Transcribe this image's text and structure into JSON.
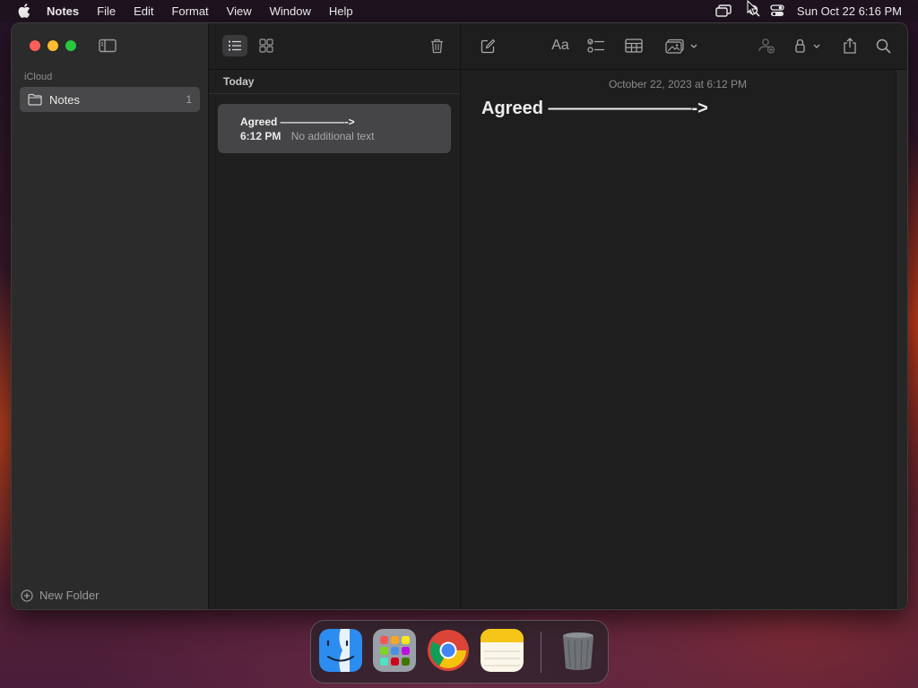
{
  "menubar": {
    "apple_icon": "apple-icon",
    "app_name": "Notes",
    "items": [
      "File",
      "Edit",
      "Format",
      "View",
      "Window",
      "Help"
    ],
    "clock": "Sun Oct 22  6:16 PM",
    "status_icons": [
      "screen-mirroring-icon",
      "spotlight-search-icon",
      "control-center-icon"
    ]
  },
  "sidebar": {
    "section_label": "iCloud",
    "folders": [
      {
        "label": "Notes",
        "count": "1",
        "icon": "folder-icon"
      }
    ],
    "new_folder_label": "New Folder"
  },
  "notelist": {
    "group_header": "Today",
    "notes": [
      {
        "title": "Agreed ——————->",
        "time": "6:12 PM",
        "preview": "No additional text"
      }
    ]
  },
  "editor": {
    "date": "October 22, 2023 at 6:12 PM",
    "title": "Agreed ————————->"
  },
  "toolbar_icons": {
    "list_view": "list-view-icon",
    "gallery_view": "gallery-view-icon",
    "delete": "trash-icon",
    "compose": "compose-icon",
    "format": "Aa",
    "checklist": "checklist-icon",
    "table": "table-icon",
    "media": "media-icon",
    "collaborate": "collaborate-icon",
    "lock": "lock-icon",
    "share": "share-icon",
    "search": "search-icon"
  },
  "dock": {
    "apps": [
      "Finder",
      "Launchpad",
      "Google Chrome",
      "Notes",
      "Trash"
    ]
  },
  "colors": {
    "close": "#ff5f57",
    "minimize": "#febc2e",
    "maximize": "#28c840",
    "window_bg": "#1e1e1e",
    "sidebar_bg": "#2b2b2c",
    "selected_row": "#48484a",
    "notes_yellow": "#f5c518"
  }
}
